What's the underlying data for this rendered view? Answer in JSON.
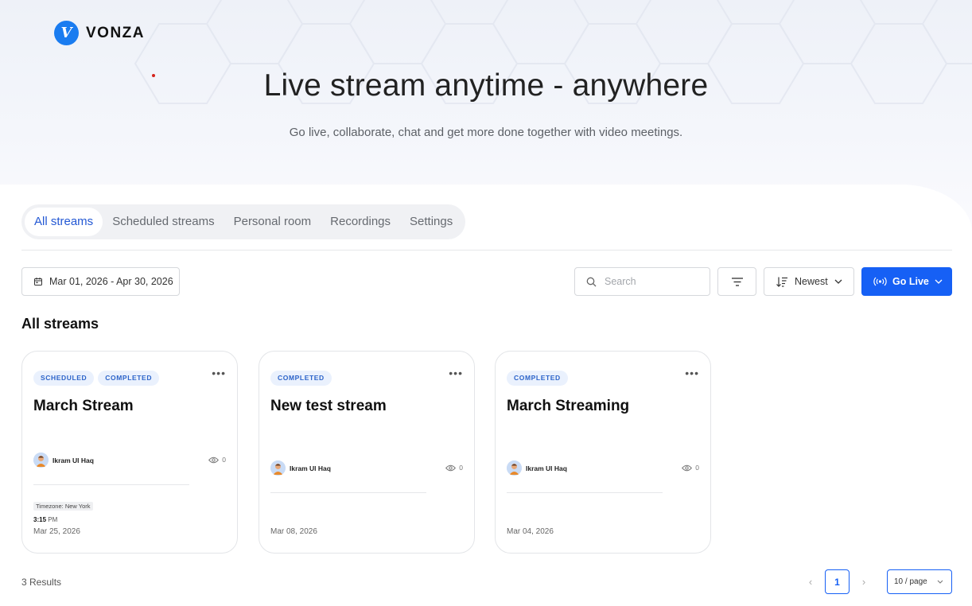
{
  "brand": {
    "name": "VONZA",
    "mark": "V",
    "color": "#1a7cf0"
  },
  "hero": {
    "title": "Live stream anytime - anywhere",
    "subtitle": "Go live, collaborate, chat and get more done together with video meetings."
  },
  "tabs": [
    {
      "label": "All streams",
      "active": true
    },
    {
      "label": "Scheduled streams",
      "active": false
    },
    {
      "label": "Personal room",
      "active": false
    },
    {
      "label": "Recordings",
      "active": false
    },
    {
      "label": "Settings",
      "active": false
    }
  ],
  "toolbar": {
    "date_range": "Mar 01, 2026 - Apr 30, 2026",
    "search_placeholder": "Search",
    "sort_label": "Newest",
    "go_live_label": "Go Live",
    "accent_color": "#1660f5"
  },
  "section_title": "All streams",
  "streams": [
    {
      "badges": [
        "SCHEDULED",
        "COMPLETED"
      ],
      "title": "March Stream",
      "owner": "Ikram Ul Haq",
      "views": "0",
      "timezone": "Timezone: New York",
      "time_bold": "3:15",
      "time_suffix": " PM",
      "date": "Mar 25, 2026"
    },
    {
      "badges": [
        "COMPLETED"
      ],
      "title": "New test stream",
      "owner": "Ikram Ul Haq",
      "views": "0",
      "date": "Mar 08, 2026"
    },
    {
      "badges": [
        "COMPLETED"
      ],
      "title": "March Streaming",
      "owner": "Ikram Ul Haq",
      "views": "0",
      "date": "Mar 04, 2026"
    }
  ],
  "pagination": {
    "results": "3 Results",
    "current_page": "1",
    "page_size": "10 / page"
  }
}
